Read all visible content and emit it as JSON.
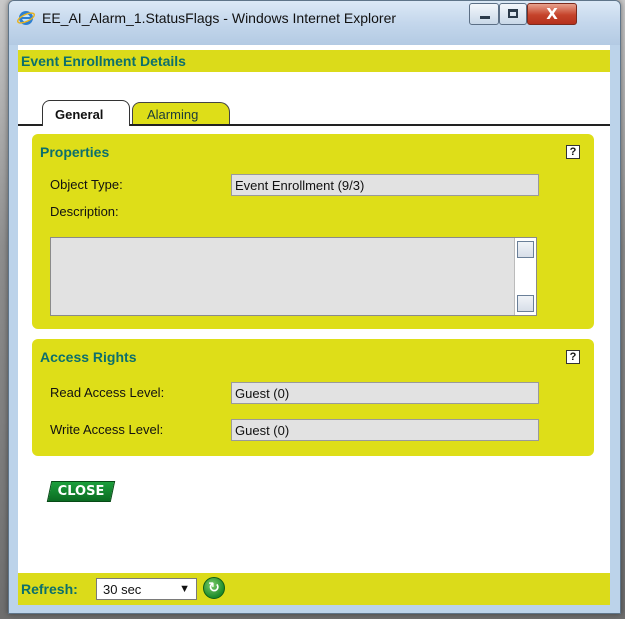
{
  "window": {
    "title": "EE_AI_Alarm_1.StatusFlags - Windows Internet Explorer",
    "app_icon": "ie-icon",
    "controls": [
      "minimize-icon",
      "maximize-icon",
      "close-icon"
    ],
    "close_glyph": "X"
  },
  "header": {
    "title": "Event Enrollment Details"
  },
  "tabs": [
    {
      "label": "General",
      "active": true
    },
    {
      "label": "Alarming",
      "active": false
    }
  ],
  "properties": {
    "title": "Properties",
    "help": "?",
    "object_type_label": "Object Type:",
    "object_type_value": "Event Enrollment (9/3)",
    "description_label": "Description:",
    "description_value": ""
  },
  "access_rights": {
    "title": "Access Rights",
    "help": "?",
    "read_label": "Read Access Level:",
    "read_value": "Guest (0)",
    "write_label": "Write Access Level:",
    "write_value": "Guest (0)"
  },
  "close_button": {
    "label": "CLOSE"
  },
  "footer": {
    "refresh_label": "Refresh:",
    "refresh_value": "30 sec",
    "refresh_icon": "refresh-icon",
    "caret": "▼",
    "refresh_glyph": "↻"
  },
  "colors": {
    "panel": "#dede18",
    "heading": "#0c6f6c",
    "close_button": "#138a30"
  }
}
